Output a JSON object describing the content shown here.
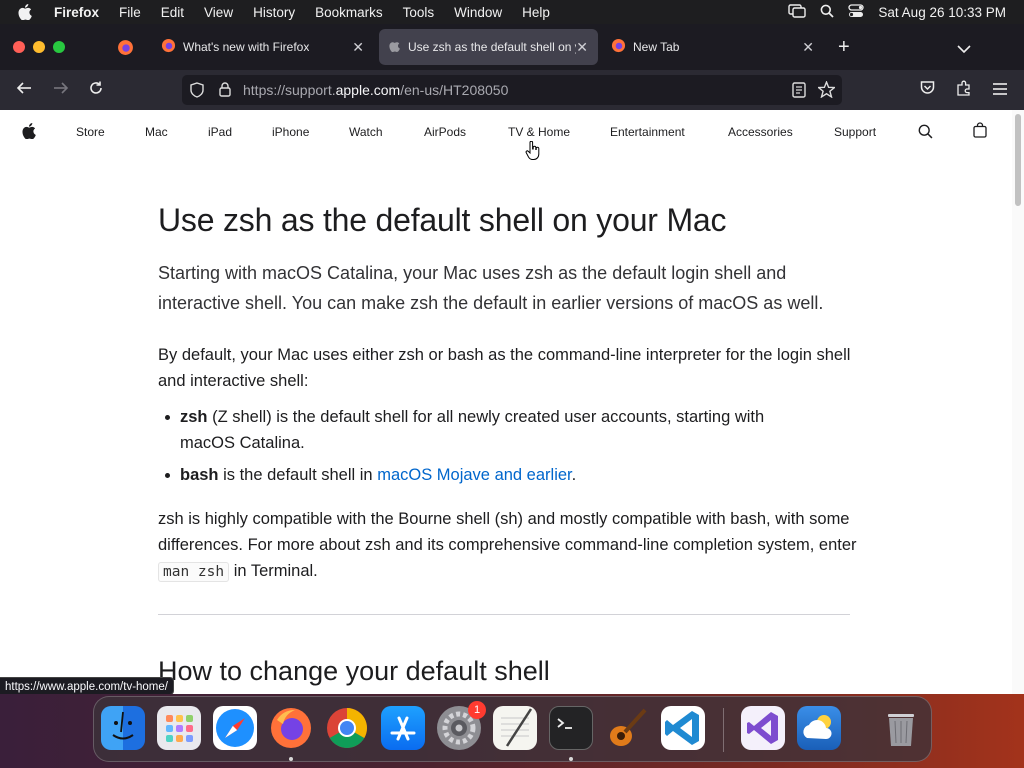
{
  "menubar": {
    "app_name": "Firefox",
    "menus": [
      "File",
      "Edit",
      "View",
      "History",
      "Bookmarks",
      "Tools",
      "Window",
      "Help"
    ],
    "datetime": "Sat Aug 26  10:33 PM"
  },
  "tabs": [
    {
      "title": "What's new with Firefox",
      "active": false
    },
    {
      "title": "Use zsh as the default shell on y",
      "active": true
    },
    {
      "title": "New Tab",
      "active": false
    }
  ],
  "navbar": {
    "url_prefix": "https://support.",
    "url_domain": "apple.com",
    "url_path": "/en-us/HT208050"
  },
  "globalnav": {
    "items": [
      "Store",
      "Mac",
      "iPad",
      "iPhone",
      "Watch",
      "AirPods",
      "TV & Home",
      "Entertainment",
      "Accessories",
      "Support"
    ]
  },
  "article": {
    "title": "Use zsh as the default shell on your Mac",
    "intro": "Starting with macOS Catalina, your Mac uses zsh as the default login shell and interactive shell. You can make zsh the default in earlier versions of macOS as well.",
    "p1": "By default, your Mac uses either zsh or bash as the command-line interpreter for the login shell and interactive shell:",
    "bullets": [
      {
        "bold": "zsh",
        "text": " (Z shell) is the default shell for all newly created user accounts, starting with macOS Catalina."
      },
      {
        "bold": "bash",
        "text": " is the default shell in ",
        "link": "macOS Mojave and earlier",
        "after": "."
      }
    ],
    "p2_before": "zsh is highly compatible with the Bourne shell (sh) and mostly compatible with bash, with some differences. For more about zsh and its comprehensive command-line completion system, enter ",
    "p2_code": "man zsh",
    "p2_after": " in Terminal.",
    "h2": "How to change your default shell"
  },
  "status_link": "https://www.apple.com/tv-home/",
  "dock": {
    "apps": [
      "Finder",
      "Launchpad",
      "Safari",
      "Firefox",
      "Chrome",
      "App Store",
      "System Preferences",
      "TextEdit",
      "Terminal",
      "GarageBand",
      "Visual Studio Code",
      "Visual Studio",
      "Weather",
      "Trash"
    ],
    "settings_badge": "1"
  }
}
